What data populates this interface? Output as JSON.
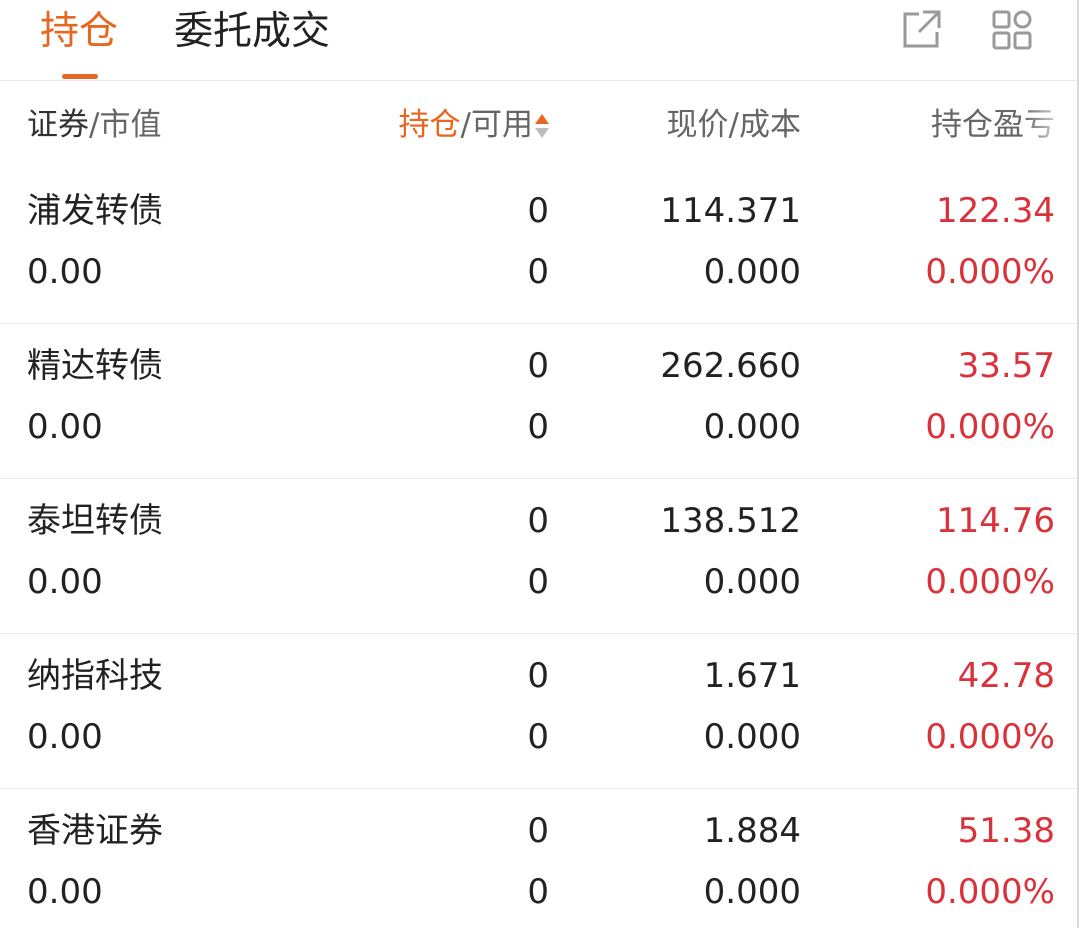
{
  "tabs": {
    "active_label": "持仓",
    "other_label": "委托成交"
  },
  "toolbar": {
    "external_icon": "external-link-icon",
    "grid_icon": "grid-apps-icon"
  },
  "columns": {
    "security_main": "证券",
    "security_sub": "/市值",
    "position_main": "持仓",
    "position_sub": "/可用",
    "price_label": "现价/成本",
    "pnl_label": "持仓盈亏"
  },
  "colors": {
    "accent": "#e8661f",
    "loss_profit_red": "#d9323a"
  },
  "holdings": [
    {
      "name": "浦发转债",
      "market_value": "0.00",
      "position": "0",
      "available": "0",
      "price": "114.371",
      "cost": "0.000",
      "pnl": "122.34",
      "pnl_pct": "0.000%"
    },
    {
      "name": "精达转债",
      "market_value": "0.00",
      "position": "0",
      "available": "0",
      "price": "262.660",
      "cost": "0.000",
      "pnl": "33.57",
      "pnl_pct": "0.000%"
    },
    {
      "name": "泰坦转债",
      "market_value": "0.00",
      "position": "0",
      "available": "0",
      "price": "138.512",
      "cost": "0.000",
      "pnl": "114.76",
      "pnl_pct": "0.000%"
    },
    {
      "name": "纳指科技",
      "market_value": "0.00",
      "position": "0",
      "available": "0",
      "price": "1.671",
      "cost": "0.000",
      "pnl": "42.78",
      "pnl_pct": "0.000%"
    },
    {
      "name": "香港证券",
      "market_value": "0.00",
      "position": "0",
      "available": "0",
      "price": "1.884",
      "cost": "0.000",
      "pnl": "51.38",
      "pnl_pct": "0.000%"
    }
  ]
}
